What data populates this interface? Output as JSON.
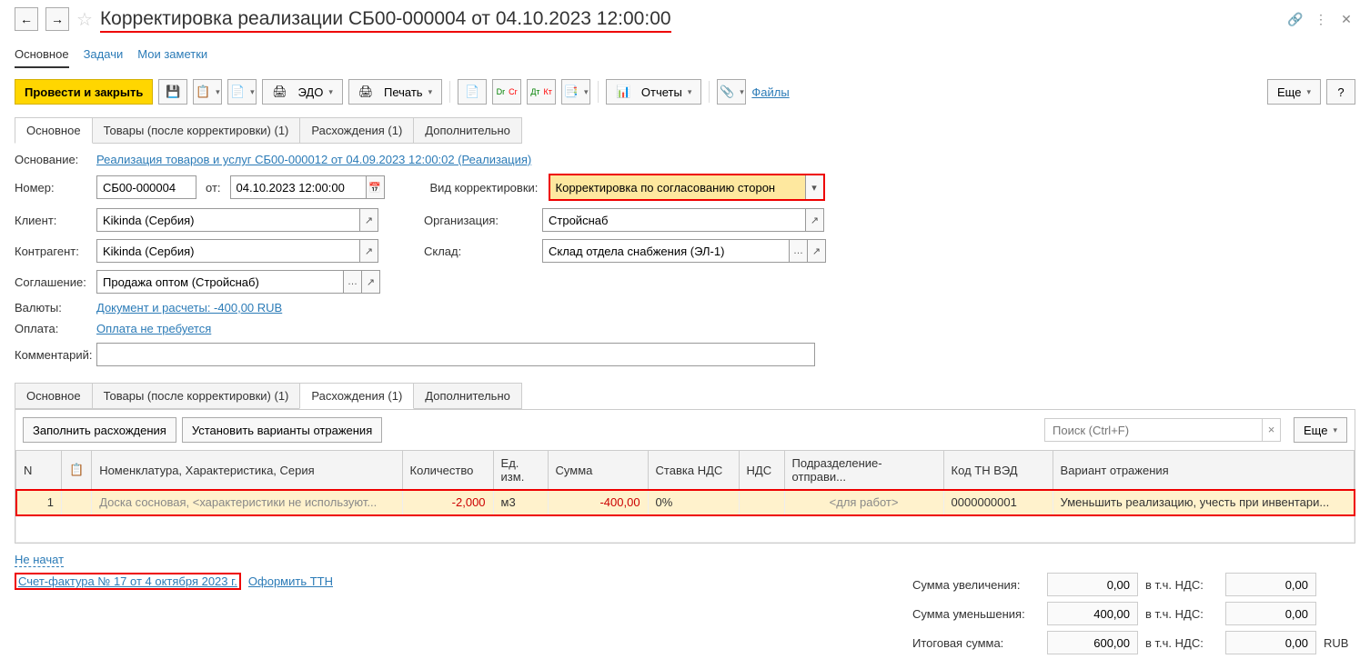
{
  "header": {
    "title": "Корректировка реализации СБ00-000004 от 04.10.2023 12:00:00"
  },
  "nav_tabs": {
    "main": "Основное",
    "tasks": "Задачи",
    "notes": "Мои заметки"
  },
  "toolbar": {
    "post_close": "Провести и закрыть",
    "edo": "ЭДО",
    "print": "Печать",
    "reports": "Отчеты",
    "files": "Файлы",
    "more": "Еще"
  },
  "form_tabs_top": {
    "main": "Основное",
    "goods": "Товары (после корректировки) (1)",
    "diff": "Расхождения (1)",
    "extra": "Дополнительно"
  },
  "fields": {
    "basis_label": "Основание:",
    "basis_link": "Реализация товаров и услуг СБ00-000012 от 04.09.2023 12:00:02 (Реализация)",
    "number_label": "Номер:",
    "number": "СБ00-000004",
    "from_label": "от:",
    "date": "04.10.2023 12:00:00",
    "corr_type_label": "Вид корректировки:",
    "corr_type": "Корректировка по согласованию сторон",
    "client_label": "Клиент:",
    "client": "Kikinda (Сербия)",
    "org_label": "Организация:",
    "org": "Стройснаб",
    "contractor_label": "Контрагент:",
    "contractor": "Kikinda (Сербия)",
    "warehouse_label": "Склад:",
    "warehouse": "Склад отдела снабжения (ЭЛ-1)",
    "agreement_label": "Соглашение:",
    "agreement": "Продажа оптом (Стройснаб)",
    "currency_label": "Валюты:",
    "currency_link": "Документ и расчеты: -400,00 RUB",
    "payment_label": "Оплата:",
    "payment_link": "Оплата не требуется",
    "comment_label": "Комментарий:"
  },
  "form_tabs_bottom": {
    "main": "Основное",
    "goods": "Товары (после корректировки) (1)",
    "diff": "Расхождения (1)",
    "extra": "Дополнительно"
  },
  "table_toolbar": {
    "fill": "Заполнить расхождения",
    "variants": "Установить варианты отражения",
    "search_placeholder": "Поиск (Ctrl+F)",
    "more": "Еще"
  },
  "table": {
    "headers": {
      "n": "N",
      "nomenclature": "Номенклатура, Характеристика, Серия",
      "qty": "Количество",
      "unit": "Ед. изм.",
      "sum": "Сумма",
      "vat_rate": "Ставка НДС",
      "vat": "НДС",
      "dept": "Подразделение-отправи...",
      "tnved": "Код ТН ВЭД",
      "variant": "Вариант отражения"
    },
    "rows": [
      {
        "n": "1",
        "nomenclature": "Доска сосновая, <характеристики не используют...",
        "qty": "-2,000",
        "unit": "м3",
        "sum": "-400,00",
        "vat_rate": "0%",
        "vat": "",
        "dept": "<для работ>",
        "tnved": "0000000001",
        "variant": "Уменьшить реализацию, учесть при инвентари..."
      }
    ]
  },
  "footer": {
    "not_started": "Не начат",
    "invoice": "Счет-фактура № 17 от 4 октября 2023 г.",
    "ttn": "Оформить ТТН",
    "sum_inc_label": "Сумма увеличения:",
    "sum_inc": "0,00",
    "vat_inc_label": "в т.ч. НДС:",
    "vat_inc": "0,00",
    "sum_dec_label": "Сумма уменьшения:",
    "sum_dec": "400,00",
    "vat_dec_label": "в т.ч. НДС:",
    "vat_dec": "0,00",
    "total_label": "Итоговая сумма:",
    "total": "600,00",
    "vat_total_label": "в т.ч. НДС:",
    "vat_total": "0,00",
    "currency": "RUB"
  }
}
